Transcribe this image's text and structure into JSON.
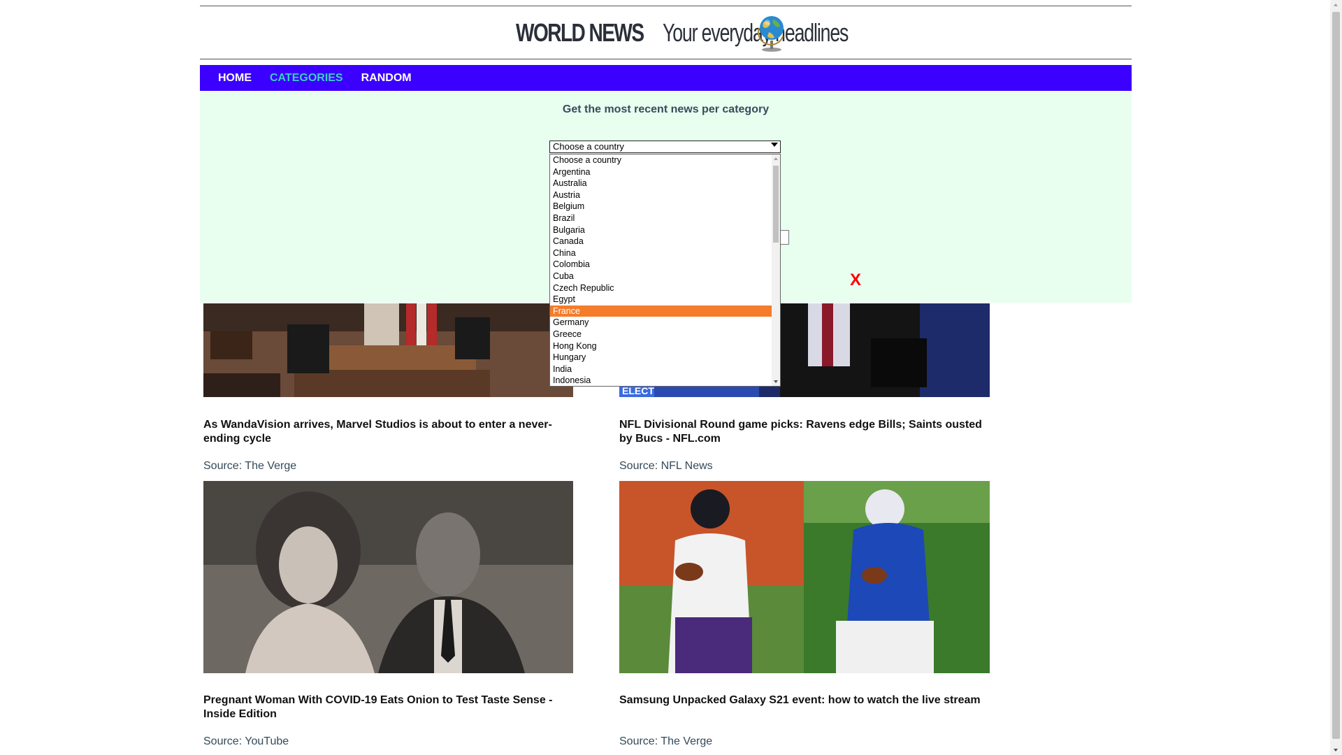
{
  "header": {
    "logo_main": "WORLD NEWS",
    "logo_sub": "Your everyday headlines"
  },
  "nav": {
    "items": [
      {
        "label": "HOME",
        "active": false
      },
      {
        "label": "CATEGORIES",
        "active": true
      },
      {
        "label": "RANDOM",
        "active": false
      }
    ]
  },
  "panel": {
    "title": "Get the most recent news per category",
    "close_label": "X",
    "country_select": {
      "value": "Choose a country",
      "options": [
        "Choose a country",
        "Argentina",
        "Australia",
        "Austria",
        "Belgium",
        "Brazil",
        "Bulgaria",
        "Canada",
        "China",
        "Colombia",
        "Cuba",
        "Czech Republic",
        "Egypt",
        "France",
        "Germany",
        "Greece",
        "Hong Kong",
        "Hungary",
        "India",
        "Indonesia"
      ],
      "highlighted": "France"
    }
  },
  "articles": [
    {
      "title": "As WandaVision arrives, Marvel Studios is about to enter a never-ending cycle",
      "source": "Source: The Verge"
    },
    {
      "title": "NFL Divisional Round game picks: Ravens edge Bills; Saints ousted by Bucs - NFL.com",
      "source": "Source: NFL News"
    },
    {
      "title": "Pregnant Woman With COVID-19 Eats Onion to Test Taste Sense - Inside Edition",
      "source": "Source: YouTube"
    },
    {
      "title": "Samsung Unpacked Galaxy S21 event: how to watch the live stream",
      "source": "Source: The Verge"
    }
  ],
  "colors": {
    "nav_bg": "#3b00ff",
    "nav_active": "#3ad1c4",
    "panel_bg": "#e8fff0",
    "dropdown_highlight": "#f57c2a",
    "close": "#ff0000"
  },
  "icons": {
    "logo_globe": "globe-icon"
  }
}
